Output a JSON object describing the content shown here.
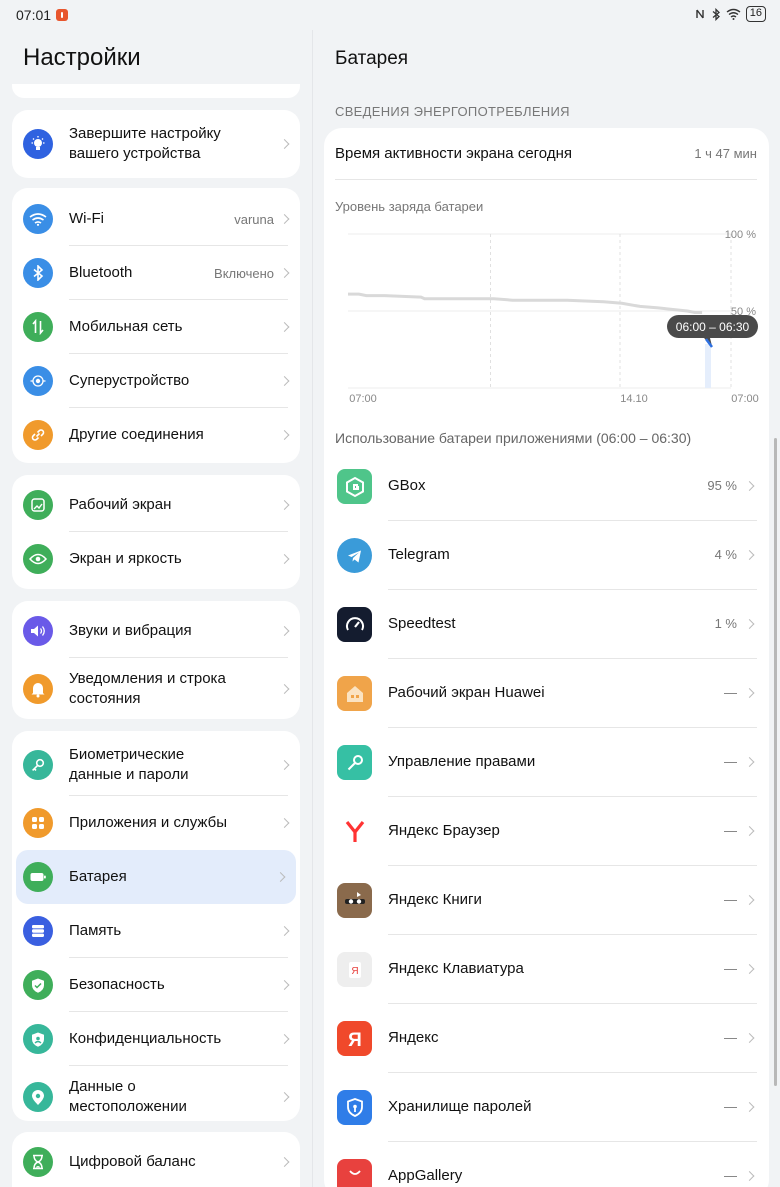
{
  "status": {
    "time": "07:01",
    "battery": "16"
  },
  "left": {
    "title": "Настройки",
    "setup": {
      "label": "Завершите настройку вашего устройства"
    },
    "connectivity": [
      {
        "label": "Wi-Fi",
        "value": "varuna",
        "icon": "wifi-icon",
        "color": "#3a8ee6"
      },
      {
        "label": "Bluetooth",
        "value": "Включено",
        "icon": "bluetooth-icon",
        "color": "#3a8ee6"
      },
      {
        "label": "Мобильная сеть",
        "value": "",
        "icon": "mobile-network-icon",
        "color": "#3fae5a"
      },
      {
        "label": "Суперустройство",
        "value": "",
        "icon": "super-device-icon",
        "color": "#3a8ee6"
      },
      {
        "label": "Другие соединения",
        "value": "",
        "icon": "link-icon",
        "color": "#f09a2c"
      }
    ],
    "display": [
      {
        "label": "Рабочий экран",
        "icon": "home-screen-icon",
        "color": "#3fae5a"
      },
      {
        "label": "Экран и яркость",
        "icon": "eye-icon",
        "color": "#3fae5a"
      }
    ],
    "sound": [
      {
        "label": "Звуки и вибрация",
        "icon": "sound-icon",
        "color": "#6a5ae8"
      },
      {
        "label": "Уведомления и строка состояния",
        "icon": "bell-icon",
        "color": "#f09a2c"
      }
    ],
    "system": [
      {
        "label": "Биометрические данные и пароли",
        "icon": "key-icon",
        "color": "#37b79a"
      },
      {
        "label": "Приложения и службы",
        "icon": "apps-icon",
        "color": "#f09a2c"
      },
      {
        "label": "Батарея",
        "icon": "battery-icon",
        "color": "#3fae5a"
      },
      {
        "label": "Память",
        "icon": "storage-icon",
        "color": "#3a5fe0"
      },
      {
        "label": "Безопасность",
        "icon": "shield-check-icon",
        "color": "#3fae5a"
      },
      {
        "label": "Конфиденциальность",
        "icon": "privacy-icon",
        "color": "#37b79a"
      },
      {
        "label": "Данные о местоположении",
        "icon": "location-icon",
        "color": "#37b79a"
      }
    ],
    "wellbeing": [
      {
        "label": "Цифровой баланс",
        "icon": "hourglass-icon",
        "color": "#3fae5a"
      }
    ]
  },
  "right": {
    "title": "Батарея",
    "section_caption": "СВЕДЕНИЯ ЭНЕРГОПОТРЕБЛЕНИЯ",
    "screen_time_label": "Время активности экрана сегодня",
    "screen_time_value": "1 ч 47 мин",
    "chart_caption": "Уровень заряда батареи",
    "usage_caption": "Использование батареи приложениями (06:00 – 06:30)",
    "apps": [
      {
        "name": "GBox",
        "pct": "95 %",
        "icon": "gbox-icon",
        "color": "#4fc58a"
      },
      {
        "name": "Telegram",
        "pct": "4 %",
        "icon": "telegram-icon",
        "color": "#3a9bd9"
      },
      {
        "name": "Speedtest",
        "pct": "1 %",
        "icon": "speedtest-icon",
        "color": "#141c2f"
      },
      {
        "name": "Рабочий экран Huawei",
        "pct": "—",
        "icon": "huawei-home-icon",
        "color": "#f0a44a"
      },
      {
        "name": "Управление правами",
        "pct": "—",
        "icon": "permissions-key-icon",
        "color": "#36c0a4"
      },
      {
        "name": "Яндекс Браузер",
        "pct": "—",
        "icon": "yandex-browser-icon",
        "color": "#ffffff"
      },
      {
        "name": "Яндекс Книги",
        "pct": "—",
        "icon": "yandex-books-icon",
        "color": "#8a6a4c"
      },
      {
        "name": "Яндекс Клавиатура",
        "pct": "—",
        "icon": "yandex-keyboard-icon",
        "color": "#eeeeee"
      },
      {
        "name": "Яндекс",
        "pct": "—",
        "icon": "yandex-icon",
        "color": "#f0492b"
      },
      {
        "name": "Хранилище паролей",
        "pct": "—",
        "icon": "password-vault-icon",
        "color": "#2f7de8"
      },
      {
        "name": "AppGallery",
        "pct": "—",
        "icon": "appgallery-icon",
        "color": "#e8413e"
      }
    ]
  },
  "chart_data": {
    "type": "line",
    "title": "Уровень заряда батареи",
    "x_ticks": [
      "07:00",
      "14.10",
      "07:00"
    ],
    "y_ticks": [
      "100 %",
      "50 %"
    ],
    "ylim": [
      0,
      100
    ],
    "series": [
      {
        "values": [
          [
            0,
            61
          ],
          [
            0.03,
            61
          ],
          [
            0.05,
            60
          ],
          [
            0.1,
            60
          ],
          [
            0.2,
            59
          ],
          [
            0.21,
            58
          ],
          [
            0.3,
            58
          ],
          [
            0.4,
            58
          ],
          [
            0.45,
            57
          ],
          [
            0.6,
            57
          ],
          [
            0.7,
            56
          ],
          [
            0.75,
            55
          ],
          [
            0.8,
            53
          ],
          [
            0.85,
            52
          ],
          [
            0.89,
            51
          ],
          [
            0.93,
            50
          ],
          [
            0.95,
            49
          ],
          [
            0.97,
            49
          ]
        ]
      }
    ],
    "tooltip": "06:00 – 06:30",
    "grid": true
  }
}
